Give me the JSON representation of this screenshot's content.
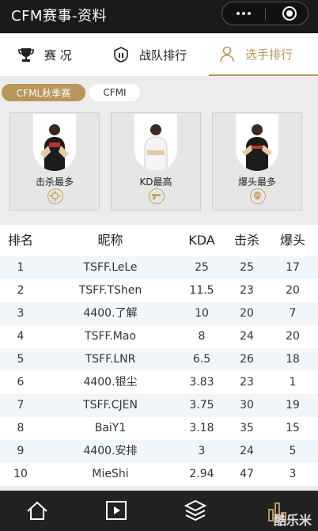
{
  "window": {
    "title": "CFM赛事-资料"
  },
  "tabs": [
    {
      "label": "赛 况",
      "icon": "trophy-icon"
    },
    {
      "label": "战队排行",
      "icon": "shield-icon"
    },
    {
      "label": "选手排行",
      "icon": "person-icon",
      "active": true
    }
  ],
  "seasons": [
    {
      "label": "CFML秋季赛",
      "active": true
    },
    {
      "label": "CFMI",
      "active": false
    }
  ],
  "highlight_cards": [
    {
      "label": "击杀最多",
      "badge_icon": "crosshair-icon"
    },
    {
      "label": "KD最高",
      "badge_icon": "pistol-icon"
    },
    {
      "label": "爆头最多",
      "badge_icon": "skull-icon"
    }
  ],
  "table": {
    "headers": {
      "rank": "排名",
      "name": "昵称",
      "kda": "KDA",
      "kills": "击杀",
      "headshots": "爆头"
    },
    "rows": [
      {
        "rank": "1",
        "name": "TSFF.LeLe",
        "kda": "25",
        "kills": "25",
        "headshots": "17"
      },
      {
        "rank": "2",
        "name": "TSFF.TShen",
        "kda": "11.5",
        "kills": "23",
        "headshots": "20"
      },
      {
        "rank": "3",
        "name": "4400.了解",
        "kda": "10",
        "kills": "20",
        "headshots": "7"
      },
      {
        "rank": "4",
        "name": "TSFF.Mao",
        "kda": "8",
        "kills": "24",
        "headshots": "20"
      },
      {
        "rank": "5",
        "name": "TSFF.LNR",
        "kda": "6.5",
        "kills": "26",
        "headshots": "18"
      },
      {
        "rank": "6",
        "name": "4400.银尘",
        "kda": "3.83",
        "kills": "23",
        "headshots": "1"
      },
      {
        "rank": "7",
        "name": "TSFF.CJEN",
        "kda": "3.75",
        "kills": "30",
        "headshots": "19"
      },
      {
        "rank": "8",
        "name": "BaiY1",
        "kda": "3.18",
        "kills": "35",
        "headshots": "15"
      },
      {
        "rank": "9",
        "name": "4400.安排",
        "kda": "3",
        "kills": "24",
        "headshots": "5"
      },
      {
        "rank": "10",
        "name": "MieShi",
        "kda": "2.94",
        "kills": "47",
        "headshots": "3"
      }
    ]
  },
  "bottom_nav": [
    {
      "icon": "home-icon"
    },
    {
      "icon": "play-icon"
    },
    {
      "icon": "layers-icon"
    },
    {
      "icon": "bar-chart-icon"
    }
  ],
  "watermark": "酷乐米",
  "colors": {
    "accent": "#b8955a",
    "titlebar": "#1a1a1a",
    "row_alt": "#f1f6fb"
  }
}
